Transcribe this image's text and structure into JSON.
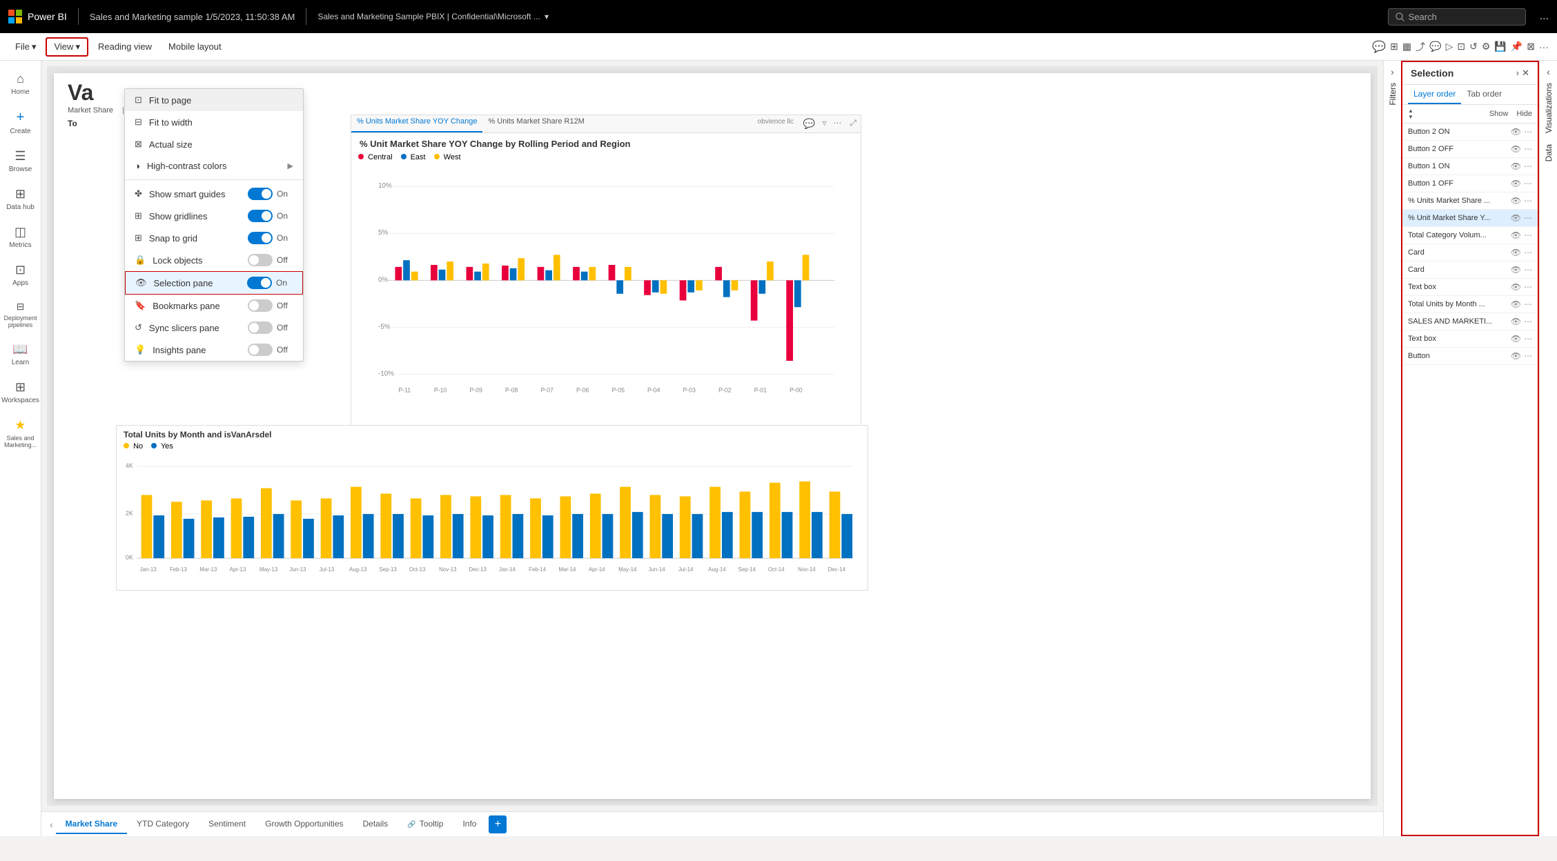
{
  "topbar": {
    "app_name": "Power BI",
    "doc_title": "Sales and Marketing sample  1/5/2023, 11:50:38 AM",
    "doc_file": "Sales and Marketing Sample PBIX  |  Confidential\\Microsoft ...",
    "search_placeholder": "Search",
    "more_label": "..."
  },
  "ribbon": {
    "file_label": "File",
    "view_label": "View",
    "reading_view_label": "Reading view",
    "mobile_layout_label": "Mobile layout"
  },
  "view_menu": {
    "fit_to_page": "Fit to page",
    "fit_to_width": "Fit to width",
    "actual_size": "Actual size",
    "high_contrast": "High-contrast colors",
    "show_smart_guides": "Show smart guides",
    "show_gridlines": "Show gridlines",
    "snap_to_grid": "Snap to grid",
    "lock_objects": "Lock objects",
    "selection_pane": "Selection pane",
    "bookmarks_pane": "Bookmarks pane",
    "sync_slicers_pane": "Sync slicers pane",
    "insights_pane": "Insights pane",
    "on_label": "On",
    "off_label": "Off"
  },
  "sidebar": {
    "items": [
      {
        "id": "home",
        "label": "Home",
        "icon": "⌂"
      },
      {
        "id": "create",
        "label": "Create",
        "icon": "+"
      },
      {
        "id": "browse",
        "label": "Browse",
        "icon": "☰"
      },
      {
        "id": "data-hub",
        "label": "Data hub",
        "icon": "⊞"
      },
      {
        "id": "metrics",
        "label": "Metrics",
        "icon": "◫"
      },
      {
        "id": "apps",
        "label": "Apps",
        "icon": "⊡"
      },
      {
        "id": "deployment",
        "label": "Deployment pipelines",
        "icon": "⊟"
      },
      {
        "id": "learn",
        "label": "Learn",
        "icon": "📖"
      },
      {
        "id": "workspaces",
        "label": "Workspaces",
        "icon": "⊞"
      },
      {
        "id": "sales",
        "label": "Sales and Marketing...",
        "icon": "★"
      }
    ]
  },
  "selection_panel": {
    "title": "Selection",
    "tab_layer_order": "Layer order",
    "tab_tab_order": "Tab order",
    "show_label": "Show",
    "hide_label": "Hide",
    "items": [
      {
        "name": "Button 2 ON",
        "active": false
      },
      {
        "name": "Button 2 OFF",
        "active": false
      },
      {
        "name": "Button 1 ON",
        "active": false
      },
      {
        "name": "Button 1 OFF",
        "active": false
      },
      {
        "name": "% Units Market Share ...",
        "active": false
      },
      {
        "name": "% Unit Market Share Y...",
        "active": true
      },
      {
        "name": "Total Category Volum...",
        "active": false
      },
      {
        "name": "Card",
        "active": false
      },
      {
        "name": "Card",
        "active": false
      },
      {
        "name": "Text box",
        "active": false
      },
      {
        "name": "Total Units by Month ...",
        "active": false
      },
      {
        "name": "SALES AND MARKETI...",
        "active": false
      },
      {
        "name": "Text box",
        "active": false
      },
      {
        "name": "Button",
        "active": false
      }
    ]
  },
  "canvas": {
    "report_title": "Va",
    "branding": "obvience llc",
    "chart1": {
      "tab1": "% Units Market Share YOY Change",
      "tab2": "% Units Market Share R12M",
      "title": "% Unit Market Share YOY Change by Rolling Period and Region",
      "legend": [
        {
          "color": "#e8003d",
          "label": "Central"
        },
        {
          "color": "#0070c0",
          "label": "East"
        },
        {
          "color": "#ffc000",
          "label": "West"
        }
      ],
      "y_labels": [
        "10%",
        "5%",
        "0%",
        "-5%",
        "-10%"
      ],
      "x_labels": [
        "P-11",
        "P-10",
        "P-09",
        "P-08",
        "P-07",
        "P-06",
        "P-05",
        "P-04",
        "P-03",
        "P-02",
        "P-01",
        "P-00"
      ]
    },
    "chart2": {
      "title": "Total Units by Month and isVanArsdel",
      "legend": [
        {
          "color": "#ffc000",
          "label": "No"
        },
        {
          "color": "#0070c0",
          "label": "Yes"
        }
      ],
      "y_labels": [
        "4K",
        "2K",
        "0K"
      ],
      "x_labels": [
        "Jan-13",
        "Feb-13",
        "Mar-13",
        "Apr-13",
        "May-13",
        "Jun-13",
        "Jul-13",
        "Aug-13",
        "Sep-13",
        "Oct-13",
        "Nov-13",
        "Dec-13",
        "Jan-14",
        "Feb-14",
        "Mar-14",
        "Apr-14",
        "May-14",
        "Jun-14",
        "Jul-14",
        "Aug-14",
        "Sep-14",
        "Oct-14",
        "Nov-14",
        "Dec-14"
      ]
    }
  },
  "page_tabs": {
    "tabs": [
      {
        "label": "Market Share",
        "active": true
      },
      {
        "label": "YTD Category",
        "active": false
      },
      {
        "label": "Sentiment",
        "active": false
      },
      {
        "label": "Growth Opportunities",
        "active": false
      },
      {
        "label": "Details",
        "active": false
      },
      {
        "label": "Tooltip",
        "active": false,
        "icon": "🔗"
      },
      {
        "label": "Info",
        "active": false
      }
    ],
    "add_label": "+"
  },
  "filters_panel": {
    "label": "Filters"
  },
  "viz_panel": {
    "label": "Visualizations",
    "data_label": "Data"
  },
  "colors": {
    "accent_blue": "#0078d4",
    "red": "#e8003d",
    "blue": "#0070c0",
    "yellow": "#ffc000",
    "brand_red": "#c00"
  }
}
